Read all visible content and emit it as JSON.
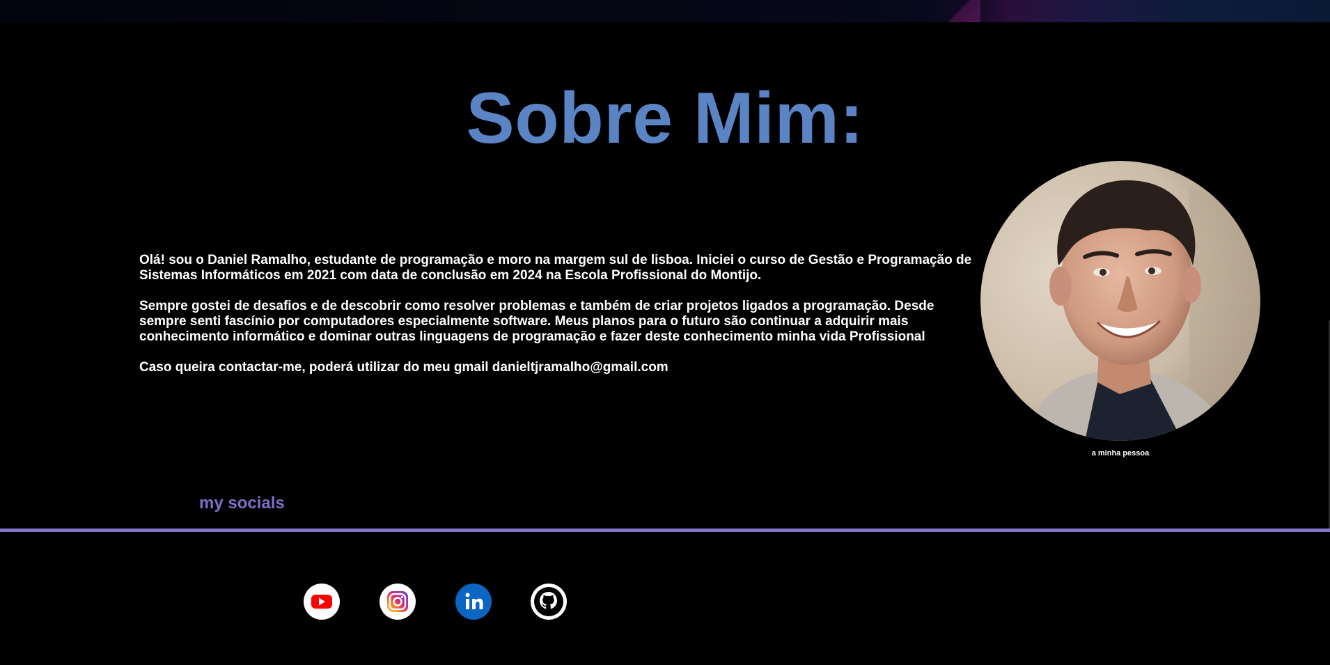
{
  "about": {
    "title": "Sobre Mim:",
    "paragraph_1": "Olá! sou o Daniel Ramalho, estudante de programação e moro na margem sul de lisboa. Iniciei o curso de Gestão e Programação de Sistemas Informáticos em 2021 com data de conclusão em 2024 na Escola Profissional do Montijo.",
    "paragraph_2": "Sempre gostei de desafios e de descobrir como resolver problemas e também de criar projetos ligados a programação. Desde sempre senti fascínio por computadores especialmente software. Meus planos para o futuro são continuar a adquirir mais conhecimento informático e dominar outras linguagens de programação e fazer deste conhecimento minha vida Profissional",
    "paragraph_3": "Caso queira contactar-me, poderá utilizar do meu gmail danieltjramalho@gmail.com",
    "photo_caption": "a minha pessoa"
  },
  "socials": {
    "title": "my socials",
    "items": [
      {
        "icon": "youtube-icon",
        "color": "#ff0000"
      },
      {
        "icon": "instagram-icon",
        "color": "#d6249f"
      },
      {
        "icon": "linkedin-icon",
        "color": "#0a66c2"
      },
      {
        "icon": "github-icon",
        "color": "#000000"
      }
    ]
  },
  "colors": {
    "title": "#5b84c4",
    "accent": "#8375c9",
    "background": "#000000",
    "text": "#ffffff"
  }
}
